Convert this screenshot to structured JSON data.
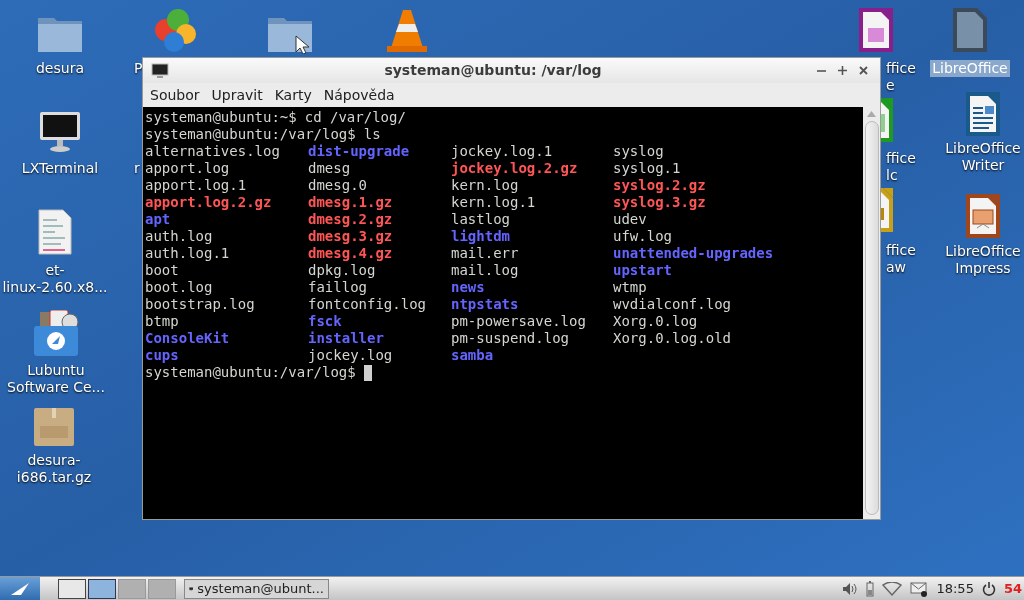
{
  "desktop_icons": [
    {
      "kind": "folder",
      "label": "desura",
      "selected": false
    },
    {
      "kind": "pinwheel",
      "label": "P",
      "selected": false
    },
    {
      "kind": "folder-link",
      "selected": false
    },
    {
      "kind": "cone",
      "selected": false
    },
    {
      "kind": "monitor",
      "label": "LXTerminal",
      "selected": false
    },
    {
      "kind": "none",
      "label": "r",
      "selected": false
    },
    {
      "kind": "document",
      "label": "et-\nlinux-2.60.x8...",
      "selected": false
    },
    {
      "kind": "software",
      "label": "Lubuntu\nSoftware Ce...",
      "selected": false
    },
    {
      "kind": "package",
      "label": "desura-\ni686.tar.gz",
      "selected": false
    },
    {
      "kind": "lo-base",
      "label": "ffice\ne",
      "selected": false
    },
    {
      "kind": "lo-calc",
      "label": "ffice\nlc",
      "selected": false
    },
    {
      "kind": "lo-draw",
      "label": "ffice\naw",
      "selected": false
    },
    {
      "kind": "lo-generic",
      "label": "LibreOffice",
      "selected": true
    },
    {
      "kind": "lo-writer",
      "label": "LibreOffice\nWriter",
      "selected": false
    },
    {
      "kind": "lo-impress",
      "label": "LibreOffice\nImpress",
      "selected": false
    }
  ],
  "terminal": {
    "title": "systeman@ubuntu: /var/log",
    "menu": [
      "Soubor",
      "Upravit",
      "Karty",
      "Nápověda"
    ],
    "commands": [
      {
        "prompt": "systeman@ubuntu:~$",
        "command": "cd /var/log/"
      },
      {
        "prompt": "systeman@ubuntu:/var/log$",
        "command": "ls"
      }
    ],
    "listing": [
      [
        {
          "text": "alternatives.log",
          "kind": "file"
        },
        {
          "text": "dist-upgrade",
          "kind": "dir"
        },
        {
          "text": "jockey.log.1",
          "kind": "file"
        },
        {
          "text": "syslog",
          "kind": "file"
        }
      ],
      [
        {
          "text": "apport.log",
          "kind": "file"
        },
        {
          "text": "dmesg",
          "kind": "file"
        },
        {
          "text": "jockey.log.2.gz",
          "kind": "archive"
        },
        {
          "text": "syslog.1",
          "kind": "file"
        }
      ],
      [
        {
          "text": "apport.log.1",
          "kind": "file"
        },
        {
          "text": "dmesg.0",
          "kind": "file"
        },
        {
          "text": "kern.log",
          "kind": "file"
        },
        {
          "text": "syslog.2.gz",
          "kind": "archive"
        }
      ],
      [
        {
          "text": "apport.log.2.gz",
          "kind": "archive"
        },
        {
          "text": "dmesg.1.gz",
          "kind": "archive"
        },
        {
          "text": "kern.log.1",
          "kind": "file"
        },
        {
          "text": "syslog.3.gz",
          "kind": "archive"
        }
      ],
      [
        {
          "text": "apt",
          "kind": "dir"
        },
        {
          "text": "dmesg.2.gz",
          "kind": "archive"
        },
        {
          "text": "lastlog",
          "kind": "file"
        },
        {
          "text": "udev",
          "kind": "file"
        }
      ],
      [
        {
          "text": "auth.log",
          "kind": "file"
        },
        {
          "text": "dmesg.3.gz",
          "kind": "archive"
        },
        {
          "text": "lightdm",
          "kind": "dir"
        },
        {
          "text": "ufw.log",
          "kind": "file"
        }
      ],
      [
        {
          "text": "auth.log.1",
          "kind": "file"
        },
        {
          "text": "dmesg.4.gz",
          "kind": "archive"
        },
        {
          "text": "mail.err",
          "kind": "file"
        },
        {
          "text": "unattended-upgrades",
          "kind": "dir"
        }
      ],
      [
        {
          "text": "boot",
          "kind": "file"
        },
        {
          "text": "dpkg.log",
          "kind": "file"
        },
        {
          "text": "mail.log",
          "kind": "file"
        },
        {
          "text": "upstart",
          "kind": "dir"
        }
      ],
      [
        {
          "text": "boot.log",
          "kind": "file"
        },
        {
          "text": "faillog",
          "kind": "file"
        },
        {
          "text": "news",
          "kind": "dir"
        },
        {
          "text": "wtmp",
          "kind": "file"
        }
      ],
      [
        {
          "text": "bootstrap.log",
          "kind": "file"
        },
        {
          "text": "fontconfig.log",
          "kind": "file"
        },
        {
          "text": "ntpstats",
          "kind": "dir"
        },
        {
          "text": "wvdialconf.log",
          "kind": "file"
        }
      ],
      [
        {
          "text": "btmp",
          "kind": "file"
        },
        {
          "text": "fsck",
          "kind": "dir"
        },
        {
          "text": "pm-powersave.log",
          "kind": "file"
        },
        {
          "text": "Xorg.0.log",
          "kind": "file"
        }
      ],
      [
        {
          "text": "ConsoleKit",
          "kind": "dir"
        },
        {
          "text": "installer",
          "kind": "dir"
        },
        {
          "text": "pm-suspend.log",
          "kind": "file"
        },
        {
          "text": "Xorg.0.log.old",
          "kind": "file"
        }
      ],
      [
        {
          "text": "cups",
          "kind": "dir"
        },
        {
          "text": "jockey.log",
          "kind": "file"
        },
        {
          "text": "samba",
          "kind": "dir"
        }
      ]
    ],
    "current_prompt": "systeman@ubuntu:/var/log$"
  },
  "taskbar": {
    "desktops": [
      {
        "selected": false
      },
      {
        "selected": true
      },
      {
        "selected": false
      },
      {
        "selected": false
      }
    ],
    "tasks": [
      {
        "label": "systeman@ubunt...",
        "selected": false
      }
    ],
    "clock": "18:55",
    "counter": "54"
  }
}
